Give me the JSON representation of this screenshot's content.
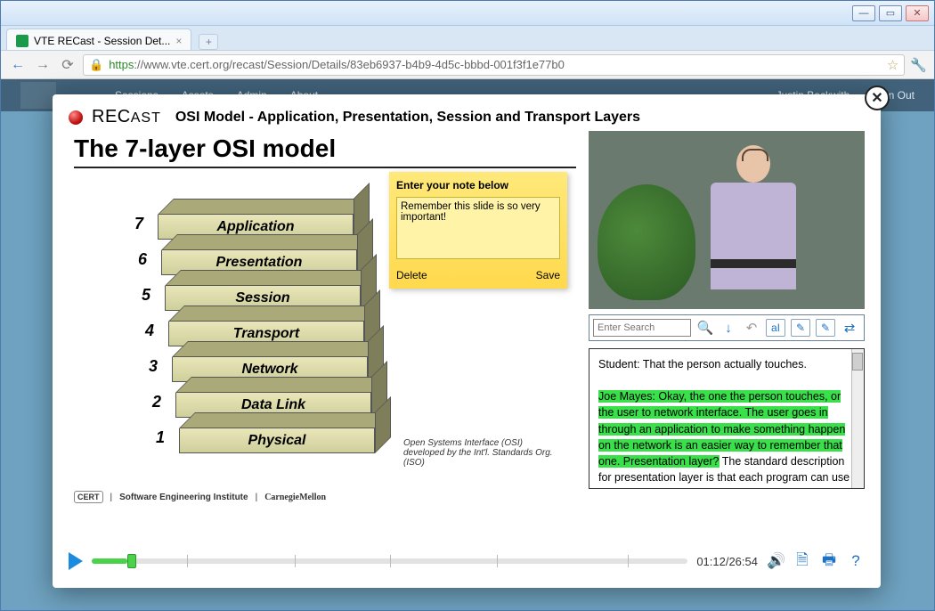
{
  "window": {
    "tab_title": "VTE RECast - Session Det...",
    "url_proto": "https",
    "url_rest": "://www.vte.cert.org/recast/Session/Details/83eb6937-b4b9-4d5c-bbbd-001f3f1e77b0"
  },
  "nav": {
    "items": [
      "Sessions",
      "Assets",
      "Admin",
      "About"
    ],
    "user": "Justin Beckwith",
    "signout": "Sign Out"
  },
  "modal": {
    "brand_main": "REC",
    "brand_cast": "AST",
    "session_title": "OSI Model - Application, Presentation, Session and Transport Layers",
    "slide_title": "The 7-layer OSI model",
    "layers": [
      {
        "n": "7",
        "name": "Application"
      },
      {
        "n": "6",
        "name": "Presentation"
      },
      {
        "n": "5",
        "name": "Session"
      },
      {
        "n": "4",
        "name": "Transport"
      },
      {
        "n": "3",
        "name": "Network"
      },
      {
        "n": "2",
        "name": "Data Link"
      },
      {
        "n": "1",
        "name": "Physical"
      }
    ],
    "slide_caption": "Open Systems Interface (OSI) developed by the Int'l. Standards Org. (ISO)",
    "footer": {
      "cert": "CERT",
      "sei": "Software Engineering Institute",
      "cmu": "CarnegieMellon"
    },
    "note": {
      "title": "Enter your note below",
      "text": "Remember this slide is so very important!",
      "delete": "Delete",
      "save": "Save"
    },
    "search": {
      "placeholder": "Enter Search"
    },
    "transcript": {
      "line1": "Student: That the person actually touches.",
      "hl": "Joe Mayes: Okay, the one the person touches, or the user to network interface.  The user goes in through an application to make something happen on the network is an easier way to remember that one. Presentation layer?",
      "after": " The standard description for presentation layer is that each program can use its"
    },
    "playback": {
      "time": "01:12/26:54"
    }
  }
}
